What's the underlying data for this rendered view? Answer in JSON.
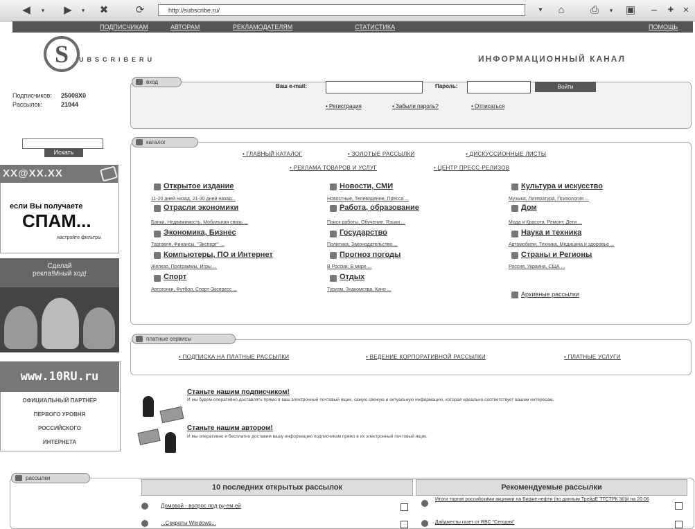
{
  "browser": {
    "address": "http://subscribe.ru/"
  },
  "topnav": {
    "subscribers": "ПОДПИСЧИКАМ",
    "authors": "АВТОРАМ",
    "advertisers": "РЕКЛАМОДАТЕЛЯМ",
    "stats": "СТАТИСТИКА",
    "help": "ПОМОЩЬ"
  },
  "logo": {
    "letter": "S",
    "name": "UBSCRIBERU",
    "tagline": "ИНФОРМАЦИОННЫЙ КАНАЛ"
  },
  "stats": {
    "subscriptions_label": "Подписчиков:",
    "subscriptions_value": "25008X0",
    "mailings_label": "Рассылок:",
    "mailings_value": "21044"
  },
  "sidebar": {
    "search_button": "Искать",
    "spam_header": "XX@XX.XX",
    "spam_line1": "если Вы получаете",
    "spam_line2": "СПАМ...",
    "spam_link": "настройте фильтры",
    "ad_line1": "Сделай",
    "ad_line2": "рекла!Мный ход!",
    "www": "www.10RU.ru",
    "partner1": "ОФИЦИАЛЬНЫЙ ПАРТНЕР",
    "partner2": "ПЕРВОГО УРОВНЯ",
    "partner3": "РОССИЙСКОГО",
    "partner4": "ИНТЕРНЕТА"
  },
  "login": {
    "tab": "вход",
    "email_label": "Ваш e-mail:",
    "password_label": "Пароль:",
    "submit": "Войти",
    "register": "Регистрация",
    "forgot": "Забыли пароль?",
    "unsubscribe": "Отписаться"
  },
  "catalog": {
    "tab": "каталог",
    "main_links": [
      "ГЛАВНЫЙ КАТАЛОГ",
      "ЗОЛОТЫЕ РАССЫЛКИ",
      "ДИСКУССИОННЫЕ ЛИСТЫ",
      "РЕКЛАМА ТОВАРОВ И УСЛУГ",
      "ЦЕНТР ПРЕСС-РЕЛИЗОВ"
    ],
    "col1": [
      {
        "title": "Открытое издание",
        "sub": "11-20 дней назад, 21-30 дней назад..."
      },
      {
        "title": "Отрасли экономики",
        "sub": "Банки, Недвижимость, Мобильная связь ..."
      },
      {
        "title": "Экономика, Бизнес",
        "sub": "Торговля, Финансы, \"Эксперт\" ..."
      },
      {
        "title": "Компьютеры, ПО и Интернет",
        "sub": "Железо, Программы, Игры ..."
      },
      {
        "title": "Спорт",
        "sub": "Автогонки, Футбол, Спорт-Экспресс ..."
      }
    ],
    "col2": [
      {
        "title": "Новости, СМИ",
        "sub": "Новостные, Телевидение, Пресса ..."
      },
      {
        "title": "Работа, образование",
        "sub": "Поиск работы, Обучение, Языки ..."
      },
      {
        "title": "Государство",
        "sub": "Политика, Законодательство ..."
      },
      {
        "title": "Прогноз погоды",
        "sub": "В России, В мире ..."
      },
      {
        "title": "Отдых",
        "sub": "Туризм, Знакомства, Кино ..."
      }
    ],
    "col3": [
      {
        "title": "Культура и искусство",
        "sub": "Музыка, Литература, Психология ..."
      },
      {
        "title": "Дом",
        "sub": "Мода и Красота, Ремонт, Дети ..."
      },
      {
        "title": "Наука и техника",
        "sub": "Автомобили, Техника, Медицина и здоровье ..."
      },
      {
        "title": "Страны и Регионы",
        "sub": "Россия, Украина, США ..."
      }
    ],
    "archive": "Архивные рассылки"
  },
  "paid": {
    "tab": "платные сервисы",
    "links": [
      "ПОДПИСКА НА ПЛАТНЫЕ РАССЫЛКИ",
      "ВЕДЕНИЕ КОРПОРАТИВНОЙ РАССЫЛКИ",
      "ПЛАТНЫЕ УСЛУГИ"
    ]
  },
  "promo": {
    "subscriber_title": "Станьте нашим подписчиком!",
    "subscriber_text": "И мы будем оперативно доставлять прямо в ваш электронный почтовый ящик, самую свежую и актуальную информацию, которая идеально соответствует вашим интересам.",
    "author_title": "Станьте нашим автором!",
    "author_text": "И мы оперативно и бесплатно доставим вашу информацию подписчикам прямо в их электронный почтовый ящик."
  },
  "bottom": {
    "tab": "рассылки",
    "latest_header": "10 последних открытых рассылок",
    "recommended_header": "Рекомендуемые рассылки",
    "latest": [
      "Домовой - вопрос под ру-ем ей",
      "...Секреты Windows..."
    ],
    "recommended": [
      "Итоги торгов российскими акциями на Бирже нефти (по данным ТрейдЕ ТТСТРК 30)й на 20.06",
      "Дайджесты газет от RBC \"Сегодня\""
    ]
  }
}
